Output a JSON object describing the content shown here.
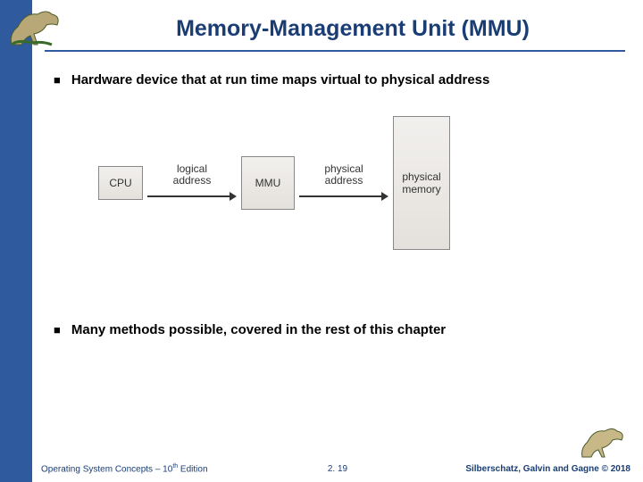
{
  "title": "Memory-Management Unit (MMU)",
  "bullets": [
    "Hardware device that at run time maps virtual to physical address",
    "Many methods possible, covered in the rest of this chapter"
  ],
  "diagram": {
    "cpu": "CPU",
    "arrow1": "logical\naddress",
    "mmu": "MMU",
    "arrow2": "physical\naddress",
    "memory_l1": "physical",
    "memory_l2": "memory"
  },
  "footer": {
    "left_prefix": "Operating System Concepts – 10",
    "left_suffix": " Edition",
    "center": "2. 19",
    "right": "Silberschatz, Galvin and Gagne © 2018"
  }
}
